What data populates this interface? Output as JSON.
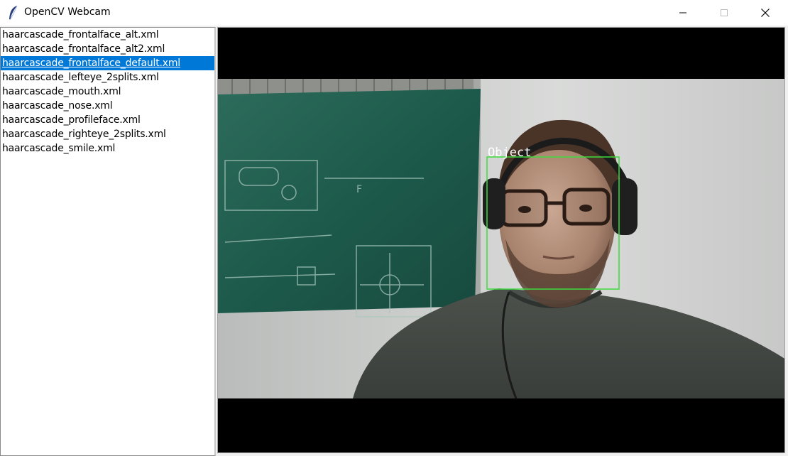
{
  "window": {
    "title": "OpenCV Webcam"
  },
  "icons": {
    "app": "feather-icon",
    "minimize": "minimize-icon",
    "maximize": "maximize-icon",
    "close": "close-icon"
  },
  "cascades": {
    "items": [
      "haarcascade_frontalface_alt.xml",
      "haarcascade_frontalface_alt2.xml",
      "haarcascade_frontalface_default.xml",
      "haarcascade_lefteye_2splits.xml",
      "haarcascade_mouth.xml",
      "haarcascade_nose.xml",
      "haarcascade_profileface.xml",
      "haarcascade_righteye_2splits.xml",
      "haarcascade_smile.xml"
    ],
    "selected_index": 2
  },
  "video": {
    "detection_label": "Object",
    "box_color": "#3ddc3d"
  },
  "colors": {
    "selection": "#0078d7",
    "board": "#1e5a4c"
  }
}
